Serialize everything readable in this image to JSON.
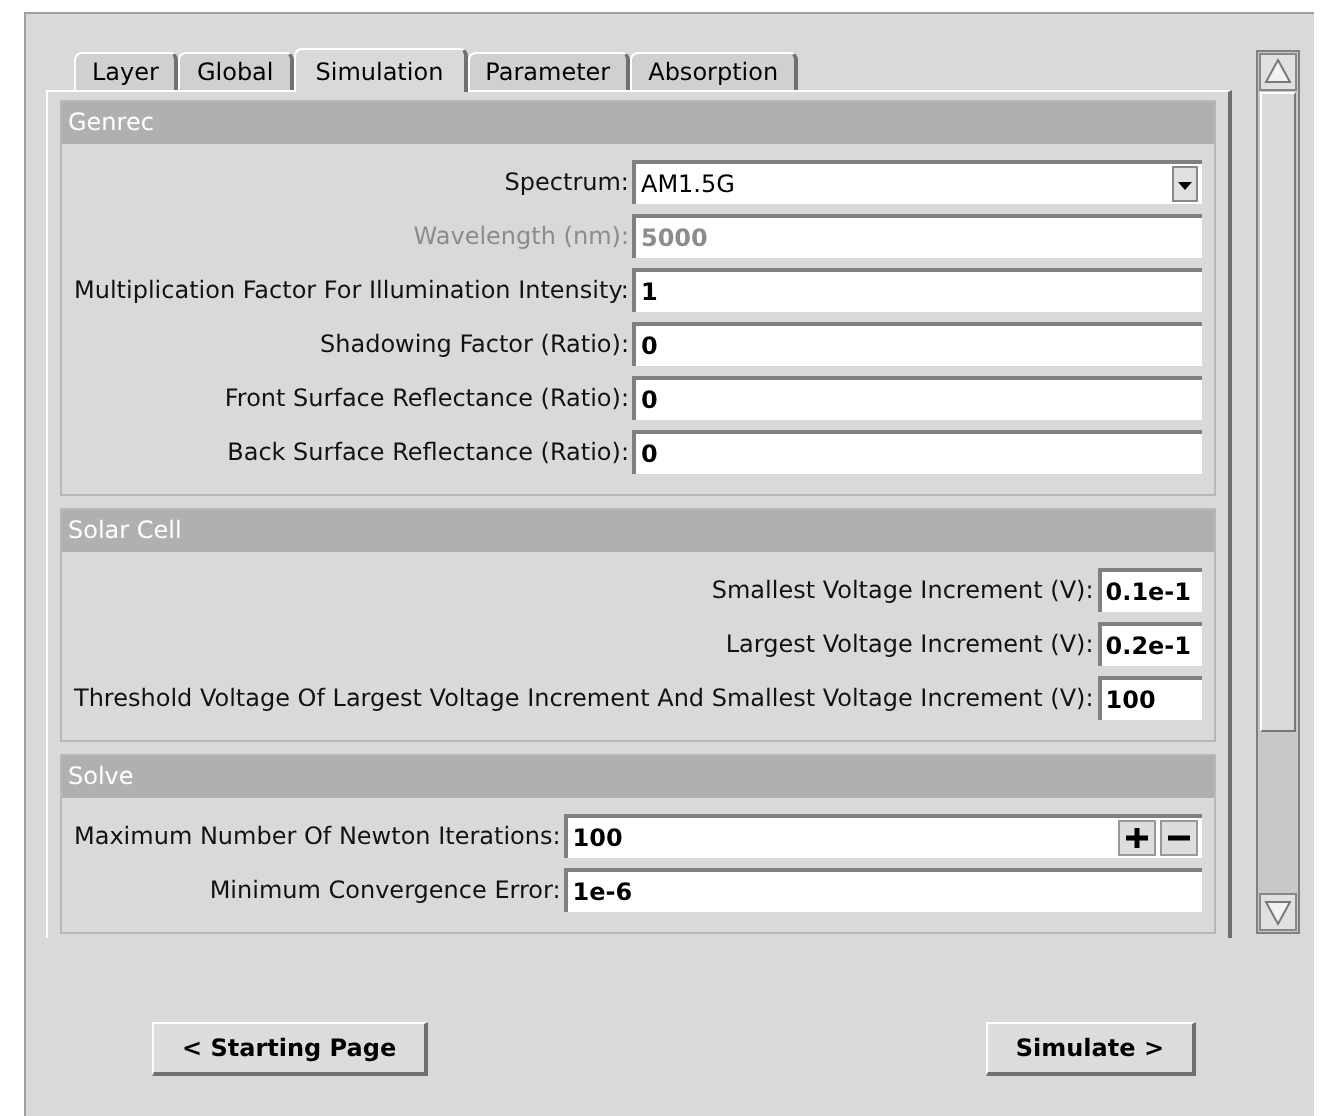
{
  "tabs": [
    {
      "label": "Layer",
      "selected": false
    },
    {
      "label": "Global",
      "selected": false
    },
    {
      "label": "Simulation",
      "selected": true
    },
    {
      "label": "Parameter",
      "selected": false
    },
    {
      "label": "Absorption",
      "selected": false
    }
  ],
  "sections": [
    {
      "title": "Genrec",
      "fields": [
        {
          "kind": "dropdown",
          "label": "Spectrum:",
          "value": "AM1.5G",
          "disabled": false
        },
        {
          "kind": "text",
          "label": "Wavelength (nm):",
          "value": "5000",
          "disabled": true
        },
        {
          "kind": "text",
          "label": "Multiplication Factor For Illumination Intensity:",
          "value": "1",
          "disabled": false
        },
        {
          "kind": "text",
          "label": "Shadowing Factor (Ratio):",
          "value": "0",
          "disabled": false
        },
        {
          "kind": "text",
          "label": "Front Surface Reflectance (Ratio):",
          "value": "0",
          "disabled": false
        },
        {
          "kind": "text",
          "label": "Back Surface Reflectance (Ratio):",
          "value": "0",
          "disabled": false
        }
      ]
    },
    {
      "title": "Solar Cell",
      "fields": [
        {
          "kind": "text",
          "label": "Smallest Voltage Increment (V):",
          "value": "0.1e-1",
          "disabled": false
        },
        {
          "kind": "text",
          "label": "Largest Voltage Increment (V):",
          "value": "0.2e-1",
          "disabled": false
        },
        {
          "kind": "text",
          "label": "Threshold Voltage Of Largest Voltage Increment And Smallest Voltage Increment (V):",
          "value": "100",
          "disabled": false
        }
      ]
    },
    {
      "title": "Solve",
      "fields": [
        {
          "kind": "spinner",
          "label": "Maximum Number Of Newton Iterations:",
          "value": "100",
          "disabled": false
        },
        {
          "kind": "text",
          "label": "Minimum Convergence Error:",
          "value": "1e-6",
          "disabled": false
        }
      ]
    }
  ],
  "buttons": [
    {
      "label": "< Starting Page"
    },
    {
      "label": "Simulate >"
    }
  ]
}
